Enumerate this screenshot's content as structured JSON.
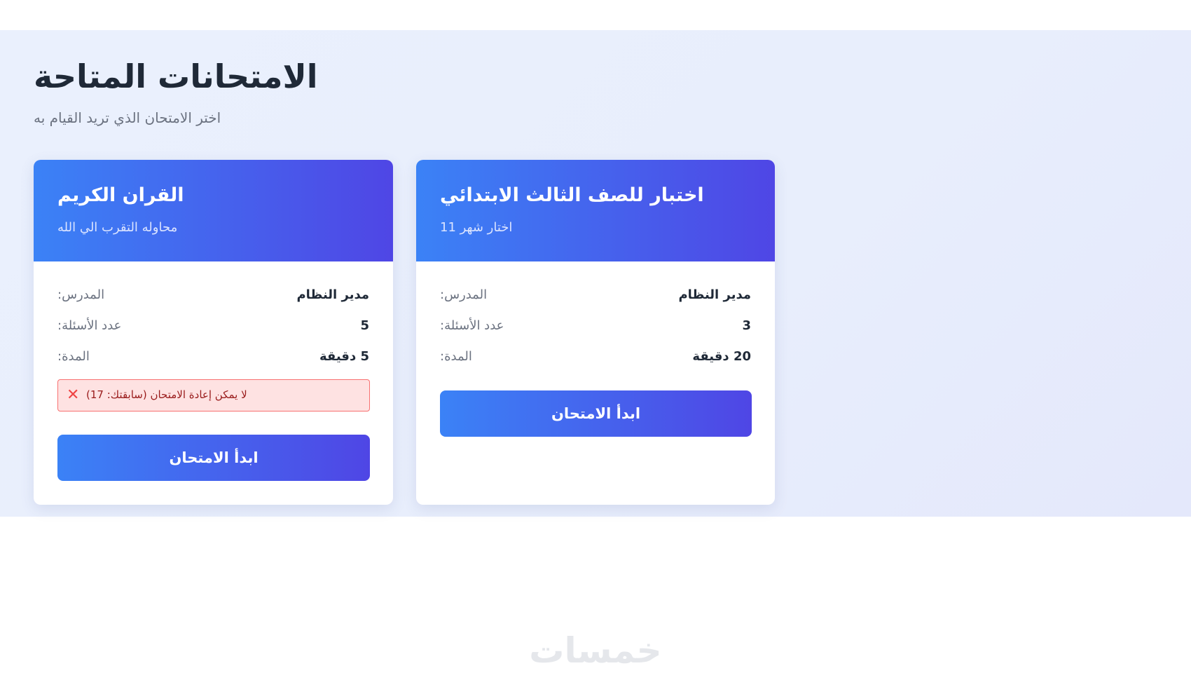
{
  "page": {
    "title": "الامتحانات المتاحة",
    "subtitle": "اختر الامتحان الذي تريد القيام به"
  },
  "colors": {
    "accent_start": "#3b82f6",
    "accent_end": "#4f46e5",
    "alert_bg": "#fee2e2",
    "alert_border": "#f87171",
    "alert_icon": "#ef4444"
  },
  "exams": [
    {
      "title": "القران الكريم",
      "description": "محاوله التقرب الي الله",
      "teacher_label": "المدرس:",
      "teacher": "مدير النظام",
      "questions_label": "عدد الأسئلة:",
      "questions": "5",
      "duration_label": "المدة:",
      "duration": "5 دقيقة",
      "alert_icon": "close-icon",
      "alert_text": "لا يمكن إعادة الامتحان (سابقتك: 17)",
      "button_label": "ابدأ الامتحان"
    },
    {
      "title": "اختبار للصف الثالث الابتدائي",
      "description": "اختار شهر 11",
      "teacher_label": "المدرس:",
      "teacher": "مدير النظام",
      "questions_label": "عدد الأسئلة:",
      "questions": "3",
      "duration_label": "المدة:",
      "duration": "20 دقيقة",
      "button_label": "ابدأ الامتحان"
    }
  ],
  "watermark": "خمسات"
}
